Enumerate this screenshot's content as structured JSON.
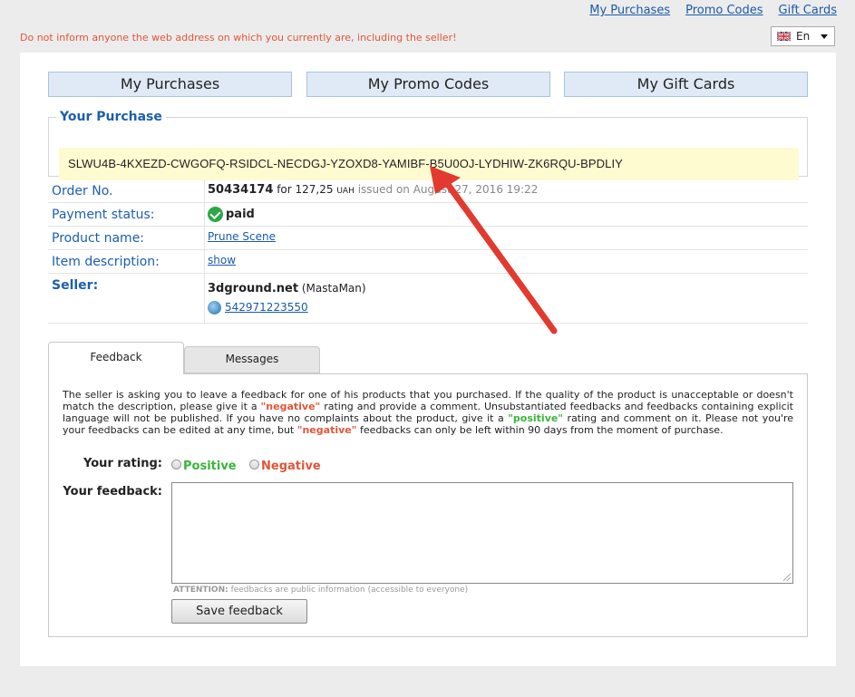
{
  "top_links": [
    "My Purchases",
    "Promo Codes",
    "Gift Cards"
  ],
  "warning": "Do not inform anyone the web address on which you currently are, including the seller!",
  "language": {
    "selected": "En",
    "icon": "uk-flag-icon"
  },
  "nav": {
    "purchases": "My Purchases",
    "promo": "My Promo Codes",
    "gift": "My Gift Cards"
  },
  "purchase": {
    "legend": "Your Purchase",
    "key": "SLWU4B-4KXEZD-CWGOFQ-RSIDCL-NECDGJ-YZOXD8-YAMIBF-B5U0OJ-LYDHIW-ZK6RQU-BPDLIY"
  },
  "order": {
    "order_label": "Order No.",
    "order_no": "50434174",
    "for_text": "for 127,25",
    "currency": "UAH",
    "issued": "issued on August 27, 2016 19:22",
    "payment_label": "Payment status:",
    "payment_status": "paid",
    "product_label": "Product name:",
    "product_name": "Prune Scene",
    "desc_label": "Item description:",
    "desc_link": "show",
    "seller_label": "Seller:",
    "seller_name": "3dground.net",
    "seller_alias": "(MastaMan)",
    "seller_wmid": "542971223550"
  },
  "tabs": {
    "feedback": "Feedback",
    "messages": "Messages"
  },
  "feedback": {
    "desc_1": "The seller is asking you to leave a feedback for one of his products that you purchased. If the quality of the product is unacceptable or doesn't match the description, please give it a ",
    "neg_word": "\"negative\"",
    "desc_2": " rating and provide a comment. Unsubstantiated feedbacks and feedbacks containing explicit language will not be published. If you have no complaints about the product, give it a ",
    "pos_word": "\"positive\"",
    "desc_3": " rating and comment on it. Please not you're your feedbacks can be edited at any time, but ",
    "neg_word_2": "\"negative\"",
    "desc_4": " feedbacks can only be left within 90 days from the moment of purchase.",
    "rating_label": "Your rating:",
    "positive": "Positive",
    "negative": "Negative",
    "feedback_label": "Your feedback:",
    "feedback_value": "",
    "attention_label": "ATTENTION:",
    "attention_text": " feedbacks are public information (accessible to everyone)",
    "save": "Save feedback"
  },
  "colors": {
    "link": "#1a5aa8",
    "label_blue": "#1c5fae",
    "key_bg": "#fffbd0",
    "warning": "#e0563a",
    "positive": "#3ab53a",
    "arrow": "#e23a2e"
  }
}
